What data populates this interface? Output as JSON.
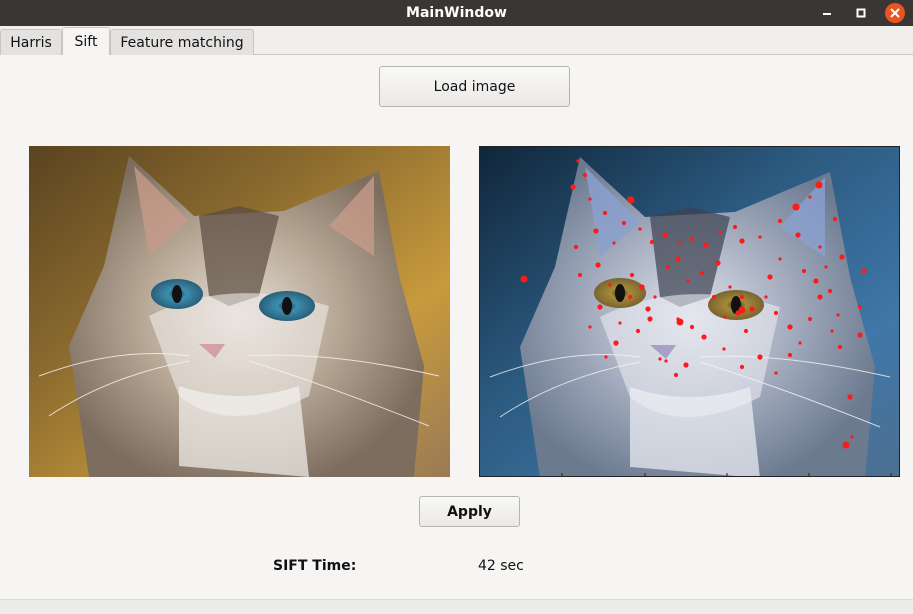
{
  "window": {
    "title": "MainWindow"
  },
  "tabs": [
    {
      "label": "Harris"
    },
    {
      "label": "Sift"
    },
    {
      "label": "Feature matching"
    }
  ],
  "main": {
    "load_button": "Load image",
    "apply_button": "Apply",
    "sift_time_label": "SIFT Time:",
    "sift_time_value": "42 sec"
  },
  "images": {
    "left": "cat photo (original)",
    "right": "cat photo with SIFT keypoints"
  },
  "colors": {
    "accent": "#e95420",
    "keypoint": "#ff1a1a",
    "titlebar": "#393634"
  }
}
